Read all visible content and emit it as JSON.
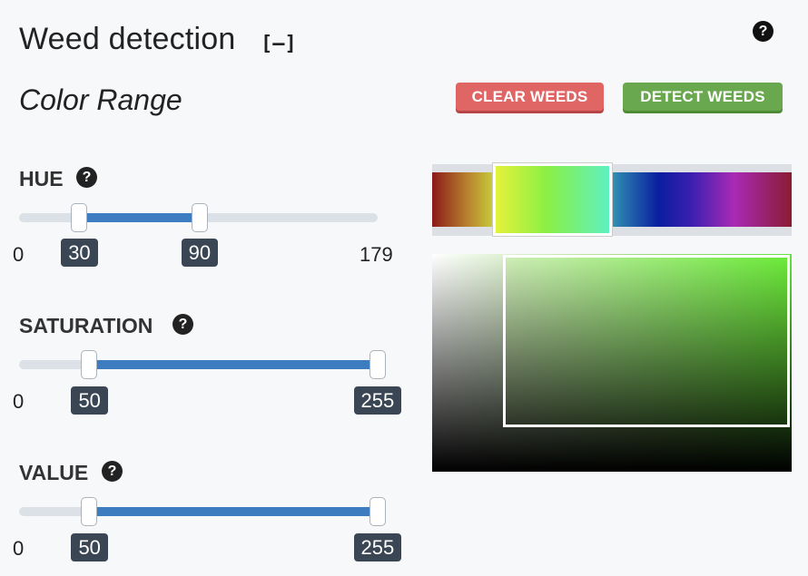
{
  "header": {
    "title": "Weed detection",
    "collapse_label": "[–]",
    "help_glyph": "?"
  },
  "section": {
    "subtitle": "Color Range"
  },
  "buttons": {
    "clear": "CLEAR WEEDS",
    "detect": "DETECT WEEDS"
  },
  "sliders": [
    {
      "label": "HUE",
      "help_glyph": "?",
      "min": 0,
      "max": 179,
      "low": 30,
      "high": 90,
      "min_text": "0",
      "max_text": "179",
      "low_text": "30",
      "high_text": "90"
    },
    {
      "label": "SATURATION",
      "help_glyph": "?",
      "min": 0,
      "max": 255,
      "low": 50,
      "high": 255,
      "min_text": "0",
      "max_text": "255",
      "low_text": "50",
      "high_text": "255"
    },
    {
      "label": "VALUE",
      "help_glyph": "?",
      "min": 0,
      "max": 255,
      "low": 50,
      "high": 255,
      "min_text": "0",
      "max_text": "255",
      "low_text": "50",
      "high_text": "255"
    }
  ],
  "colors": {
    "clear_button": "#e06666",
    "detect_button": "#6aa84f",
    "slider_fill": "#3d7dbf",
    "tooltip_bg": "#3a4654"
  }
}
